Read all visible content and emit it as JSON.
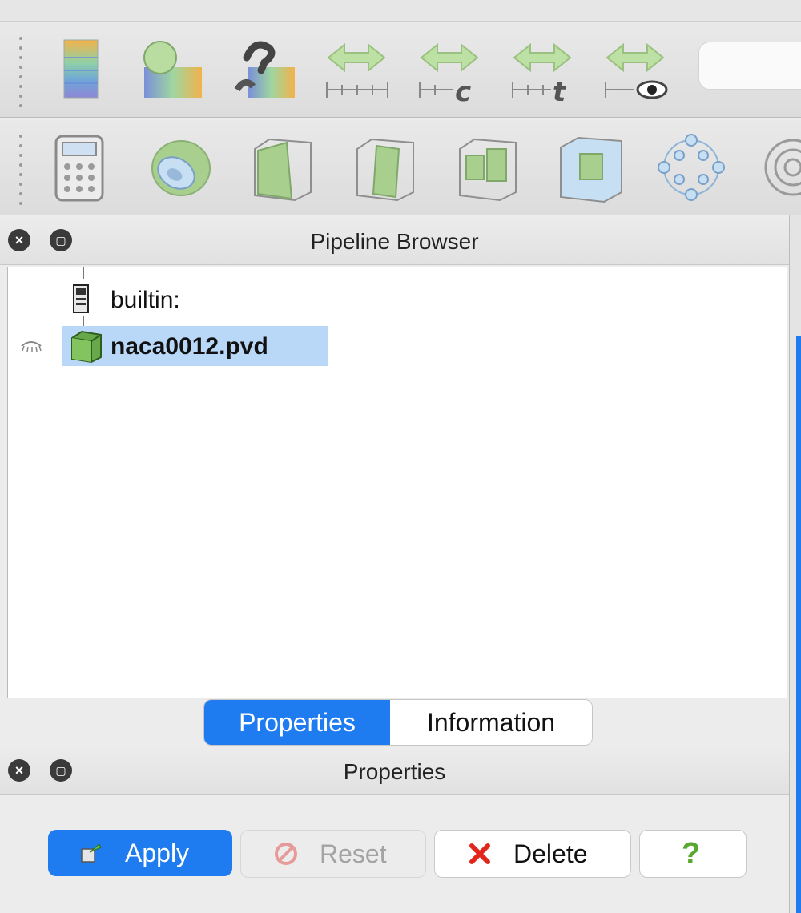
{
  "pipeline_browser": {
    "title": "Pipeline Browser",
    "items": [
      {
        "label": "builtin:",
        "icon": "server-icon"
      },
      {
        "label": "naca0012.pvd",
        "icon": "dataset-cube-icon",
        "selected": true,
        "visibility_icon": "eye-closed-icon"
      }
    ]
  },
  "tabs": [
    {
      "label": "Properties",
      "active": true
    },
    {
      "label": "Information",
      "active": false
    }
  ],
  "properties_panel": {
    "title": "Properties",
    "buttons": {
      "apply": "Apply",
      "reset": "Reset",
      "delete": "Delete",
      "help": "?"
    }
  },
  "toolbar1_icons": [
    "color-legend-icon",
    "edit-colormap-icon",
    "reset-range-icon",
    "rescale-data-range-icon",
    "rescale-custom-range-icon",
    "rescale-temporal-range-icon",
    "rescale-visible-range-icon"
  ],
  "toolbar2_icons": [
    "calculator-icon",
    "contour-icon",
    "clip-icon",
    "slice-icon",
    "threshold-icon",
    "extract-subset-icon",
    "glyph-icon",
    "stream-tracer-icon"
  ],
  "colors": {
    "accent": "#1f7cf0",
    "selection": "#b9d7f7",
    "icon_green": "#a8cf8e"
  }
}
